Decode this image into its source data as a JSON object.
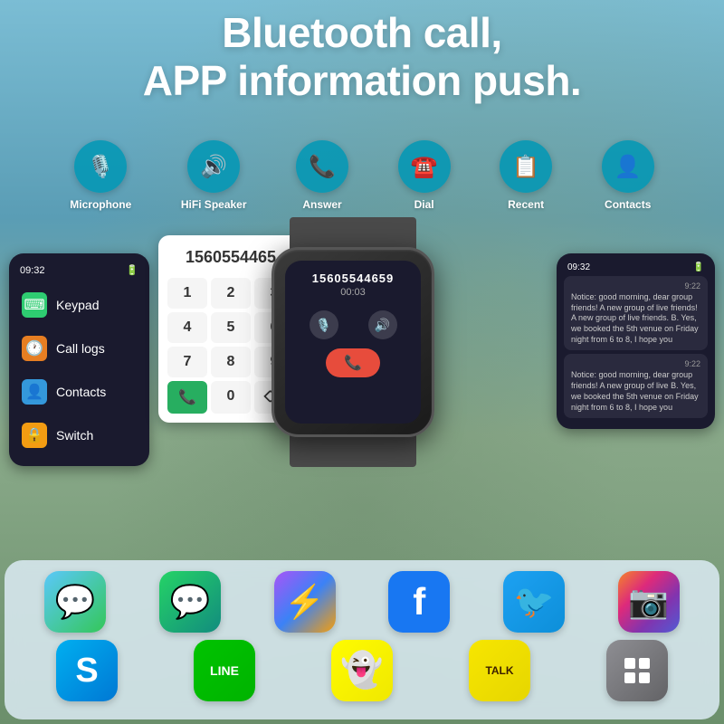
{
  "header": {
    "line1": "Bluetooth call,",
    "line2": "APP information push."
  },
  "features": [
    {
      "id": "microphone",
      "label": "Microphone",
      "icon": "🎙️",
      "color": "#0096b4"
    },
    {
      "id": "hifi-speaker",
      "label": "HiFi Speaker",
      "icon": "🔊",
      "color": "#0096b4"
    },
    {
      "id": "answer",
      "label": "Answer",
      "icon": "📞",
      "color": "#0096b4"
    },
    {
      "id": "dial",
      "label": "Dial",
      "icon": "☎️",
      "color": "#0096b4"
    },
    {
      "id": "recent",
      "label": "Recent",
      "icon": "📋",
      "color": "#0096b4"
    },
    {
      "id": "contacts",
      "label": "Contacts",
      "icon": "👤",
      "color": "#0096b4"
    }
  ],
  "phone_menu": {
    "time": "09:32",
    "battery": "🔋",
    "items": [
      {
        "id": "keypad",
        "label": "Keypad",
        "icon": "⌨️",
        "icon_color": "green"
      },
      {
        "id": "call-logs",
        "label": "Call logs",
        "icon": "🕐",
        "icon_color": "orange"
      },
      {
        "id": "contacts",
        "label": "Contacts",
        "icon": "👤",
        "icon_color": "blue"
      },
      {
        "id": "switch",
        "label": "Switch",
        "icon": "🔒",
        "icon_color": "gold"
      }
    ]
  },
  "dial_pad": {
    "display_number": "1560554465",
    "keys": [
      "1",
      "2",
      "3",
      "4",
      "5",
      "6",
      "7",
      "8",
      "9",
      "📞",
      "0",
      "⌫"
    ]
  },
  "watch": {
    "call_number": "15605544659",
    "call_duration": "00:03",
    "mute_icon": "🎙️",
    "volume_icon": "🔊",
    "end_icon": "📞"
  },
  "notifications": {
    "time": "09:32",
    "battery": "🔋",
    "items": [
      {
        "time": "9:22",
        "text": "Notice: good morning, dear group friends! A new group of live friends! A new group of live friends. B. Yes, we booked the 5th venue on Friday night from 6 to 8, I hope you"
      },
      {
        "time": "9:22",
        "text": "Notice: good morning, dear group friends! A new group of live B. Yes, we booked the 5th venue on Friday night from 6 to 8, I hope you"
      }
    ]
  },
  "apps_row1": [
    {
      "id": "imessage",
      "label": "iMessage",
      "emoji": "💬",
      "class": "app-imessage"
    },
    {
      "id": "whatsapp",
      "label": "WhatsApp",
      "emoji": "💬",
      "class": "app-whatsapp"
    },
    {
      "id": "messenger",
      "label": "Messenger",
      "emoji": "⚡",
      "class": "app-messenger"
    },
    {
      "id": "facebook",
      "label": "Facebook",
      "emoji": "f",
      "class": "app-facebook"
    },
    {
      "id": "twitter",
      "label": "Twitter",
      "emoji": "🐦",
      "class": "app-twitter"
    },
    {
      "id": "instagram",
      "label": "Instagram",
      "emoji": "📷",
      "class": "app-instagram"
    }
  ],
  "apps_row2": [
    {
      "id": "skype",
      "label": "Skype",
      "emoji": "S",
      "class": "app-skype"
    },
    {
      "id": "line",
      "label": "LINE",
      "emoji": "LINE",
      "class": "app-line"
    },
    {
      "id": "snapchat",
      "label": "Snapchat",
      "emoji": "👻",
      "class": "app-snapchat"
    },
    {
      "id": "kakaotalk",
      "label": "KakaoTalk",
      "emoji": "TALK",
      "class": "app-kakaotalk"
    },
    {
      "id": "grid-app",
      "label": "Grid App",
      "emoji": "⊞",
      "class": "app-grid"
    }
  ]
}
